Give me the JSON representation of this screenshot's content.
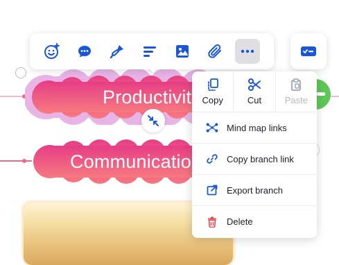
{
  "nodes": {
    "productivity": {
      "label": "Productivity"
    },
    "communication": {
      "label": "Communication"
    }
  },
  "toolbar": {
    "buttons": [
      {
        "name": "emoji-icon"
      },
      {
        "name": "comment-icon"
      },
      {
        "name": "paint-brush-icon"
      },
      {
        "name": "text-format-icon"
      },
      {
        "name": "image-icon"
      },
      {
        "name": "attachment-icon"
      },
      {
        "name": "more-icon",
        "active": true
      }
    ],
    "side_button": {
      "name": "task-icon"
    }
  },
  "context_menu": {
    "top_actions": [
      {
        "label": "Copy",
        "icon": "copy-icon",
        "enabled": true
      },
      {
        "label": "Cut",
        "icon": "scissors-icon",
        "enabled": true
      },
      {
        "label": "Paste",
        "icon": "paste-icon",
        "enabled": false
      }
    ],
    "items": [
      {
        "label": "Mind map links",
        "icon": "mind-map-links-icon"
      },
      {
        "label": "Copy branch link",
        "icon": "link-icon"
      },
      {
        "label": "Export branch",
        "icon": "export-icon"
      },
      {
        "label": "Delete",
        "icon": "trash-icon"
      }
    ]
  },
  "colors": {
    "accent": "#1a56db",
    "topic_fill_top": "#e94a8a",
    "topic_fill_bottom": "#f56b80",
    "topic_halo": "#e9b4e6",
    "delete": "#e5484d",
    "connector": "#f06a86",
    "green_node": "#5cc957"
  }
}
